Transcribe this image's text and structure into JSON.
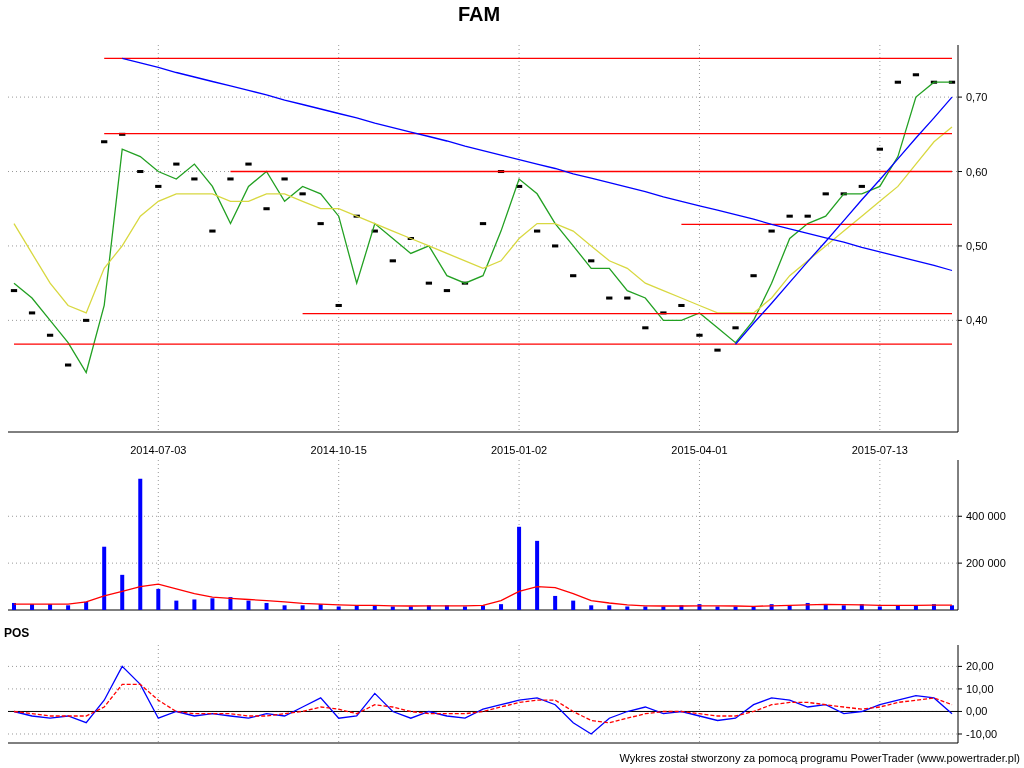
{
  "title": "FAM",
  "price_chart": {
    "chart_data": {
      "type": "line",
      "grid": true,
      "categories": [
        null,
        null,
        null,
        null,
        null,
        null,
        null,
        null,
        "2014-07-03",
        null,
        null,
        null,
        null,
        null,
        null,
        null,
        null,
        null,
        "2014-10-15",
        null,
        null,
        null,
        null,
        null,
        null,
        null,
        null,
        null,
        "2015-01-02",
        null,
        null,
        null,
        null,
        null,
        null,
        null,
        null,
        null,
        "2015-04-01",
        null,
        null,
        null,
        null,
        null,
        null,
        null,
        null,
        null,
        "2015-07-13",
        null,
        null,
        null,
        null
      ],
      "ylim": [
        0.25,
        0.77
      ],
      "yticks": [
        {
          "value": 0.4,
          "label": "0,40"
        },
        {
          "value": 0.5,
          "label": "0,50"
        },
        {
          "value": 0.6,
          "label": "0,60"
        },
        {
          "value": 0.7,
          "label": "0,70"
        }
      ],
      "series": [
        {
          "type": "scatter",
          "color": "#000000",
          "values": [
            0.44,
            0.41,
            0.38,
            0.34,
            0.4,
            0.64,
            0.65,
            0.6,
            0.58,
            0.61,
            0.59,
            0.52,
            0.59,
            0.61,
            0.55,
            0.59,
            0.57,
            0.53,
            0.42,
            0.54,
            0.52,
            0.48,
            0.51,
            0.45,
            0.44,
            0.45,
            0.53,
            0.6,
            0.58,
            0.52,
            0.5,
            0.46,
            0.48,
            0.43,
            0.43,
            0.39,
            0.41,
            0.42,
            0.38,
            0.36,
            0.39,
            0.46,
            0.52,
            0.54,
            0.54,
            0.57,
            0.57,
            0.58,
            0.63,
            0.72,
            0.73,
            0.72,
            0.72
          ]
        },
        {
          "color": "#22a022",
          "values": [
            0.45,
            0.43,
            0.4,
            0.37,
            0.33,
            0.42,
            0.63,
            0.62,
            0.6,
            0.59,
            0.61,
            0.58,
            0.53,
            0.58,
            0.6,
            0.56,
            0.58,
            0.57,
            0.54,
            0.45,
            0.53,
            0.51,
            0.49,
            0.5,
            0.46,
            0.45,
            0.46,
            0.52,
            0.59,
            0.57,
            0.53,
            0.5,
            0.47,
            0.47,
            0.44,
            0.43,
            0.4,
            0.4,
            0.41,
            0.39,
            0.37,
            0.4,
            0.45,
            0.51,
            0.53,
            0.54,
            0.57,
            0.57,
            0.58,
            0.62,
            0.7,
            0.72,
            0.72
          ]
        },
        {
          "color": "#d8d840",
          "values": [
            0.53,
            0.49,
            0.45,
            0.42,
            0.41,
            0.47,
            0.5,
            0.54,
            0.56,
            0.57,
            0.57,
            0.57,
            0.56,
            0.56,
            0.57,
            0.57,
            0.56,
            0.55,
            0.55,
            0.54,
            0.53,
            0.52,
            0.51,
            0.5,
            0.49,
            0.48,
            0.47,
            0.48,
            0.51,
            0.53,
            0.53,
            0.52,
            0.5,
            0.48,
            0.47,
            0.45,
            0.44,
            0.43,
            0.42,
            0.41,
            0.41,
            0.41,
            0.43,
            0.46,
            0.48,
            0.5,
            0.52,
            0.54,
            0.56,
            0.58,
            0.61,
            0.64,
            0.66
          ]
        },
        {
          "color": "#ff0000",
          "values": [
            null,
            null,
            null,
            null,
            null,
            0.752,
            0.752,
            0.752,
            0.752,
            0.752,
            0.752,
            0.752,
            0.752,
            0.752,
            0.752,
            0.752,
            0.752,
            0.752,
            0.752,
            0.752,
            0.752,
            0.752,
            0.752,
            0.752,
            0.752,
            0.752,
            0.752,
            0.752,
            0.752,
            0.752,
            0.752,
            0.752,
            0.752,
            0.752,
            0.752,
            0.752,
            0.752,
            0.752,
            0.752,
            0.752,
            0.752,
            0.752,
            0.752,
            0.752,
            0.752,
            0.752,
            0.752,
            0.752,
            0.752,
            0.752,
            0.752,
            0.752,
            0.752
          ]
        },
        {
          "color": "#ff0000",
          "values": [
            null,
            null,
            null,
            null,
            null,
            0.651,
            0.651,
            0.651,
            0.651,
            0.651,
            0.651,
            0.651,
            0.651,
            0.651,
            0.651,
            0.651,
            0.651,
            0.651,
            0.651,
            0.651,
            0.651,
            0.651,
            0.651,
            0.651,
            0.651,
            0.651,
            0.651,
            0.651,
            0.651,
            0.651,
            0.651,
            0.651,
            0.651,
            0.651,
            0.651,
            0.651,
            0.651,
            0.651,
            0.651,
            0.651,
            0.651,
            0.651,
            0.651,
            0.651,
            0.651,
            0.651,
            0.651,
            0.651,
            0.651,
            0.651,
            0.651,
            0.651,
            0.651
          ]
        },
        {
          "color": "#ff0000",
          "values": [
            null,
            null,
            null,
            null,
            null,
            null,
            null,
            null,
            null,
            null,
            null,
            null,
            0.6,
            0.6,
            0.6,
            0.6,
            0.6,
            0.6,
            0.6,
            0.6,
            0.6,
            0.6,
            0.6,
            0.6,
            0.6,
            0.6,
            0.6,
            0.6,
            0.6,
            0.6,
            0.6,
            0.6,
            0.6,
            0.6,
            0.6,
            0.6,
            0.6,
            0.6,
            0.6,
            0.6,
            0.6,
            0.6,
            0.6,
            0.6,
            0.6,
            0.6,
            0.6,
            0.6,
            0.6,
            0.6,
            0.6,
            0.6,
            0.6
          ]
        },
        {
          "color": "#ff0000",
          "values": [
            null,
            null,
            null,
            null,
            null,
            null,
            null,
            null,
            null,
            null,
            null,
            null,
            null,
            null,
            null,
            null,
            null,
            null,
            null,
            null,
            null,
            null,
            null,
            null,
            null,
            null,
            null,
            null,
            null,
            null,
            null,
            null,
            null,
            null,
            null,
            null,
            null,
            0.529,
            0.529,
            0.529,
            0.529,
            0.529,
            0.529,
            0.529,
            0.529,
            0.529,
            0.529,
            0.529,
            0.529,
            0.529,
            0.529,
            0.529,
            0.529
          ]
        },
        {
          "color": "#ff0000",
          "values": [
            null,
            null,
            null,
            null,
            null,
            null,
            null,
            null,
            null,
            null,
            null,
            null,
            null,
            null,
            null,
            null,
            0.409,
            0.409,
            0.409,
            0.409,
            0.409,
            0.409,
            0.409,
            0.409,
            0.409,
            0.409,
            0.409,
            0.409,
            0.409,
            0.409,
            0.409,
            0.409,
            0.409,
            0.409,
            0.409,
            0.409,
            0.409,
            0.409,
            0.409,
            0.409,
            0.409,
            0.409,
            0.409,
            0.409,
            0.409,
            0.409,
            0.409,
            0.409,
            0.409,
            0.409,
            0.409,
            0.409,
            0.409
          ]
        },
        {
          "color": "#ff0000",
          "values": [
            0.368,
            0.368,
            0.368,
            0.368,
            0.368,
            0.368,
            0.368,
            0.368,
            0.368,
            0.368,
            0.368,
            0.368,
            0.368,
            0.368,
            0.368,
            0.368,
            0.368,
            0.368,
            0.368,
            0.368,
            0.368,
            0.368,
            0.368,
            0.368,
            0.368,
            0.368,
            0.368,
            0.368,
            0.368,
            0.368,
            0.368,
            0.368,
            0.368,
            0.368,
            0.368,
            0.368,
            0.368,
            0.368,
            0.368,
            0.368,
            0.368,
            0.368,
            0.368,
            0.368,
            0.368,
            0.368,
            0.368,
            0.368,
            0.368,
            0.368,
            0.368,
            0.368,
            0.368
          ]
        },
        {
          "color": "#0000ff",
          "values": [
            null,
            null,
            null,
            null,
            null,
            null,
            0.752,
            0.746,
            0.74,
            0.733,
            0.727,
            0.721,
            0.715,
            0.709,
            0.703,
            0.696,
            0.69,
            0.684,
            0.678,
            0.672,
            0.665,
            0.659,
            0.653,
            0.647,
            0.641,
            0.634,
            0.628,
            0.622,
            0.616,
            0.61,
            0.604,
            0.597,
            0.591,
            0.585,
            0.579,
            0.573,
            0.566,
            0.56,
            0.554,
            0.548,
            0.542,
            0.536,
            0.529,
            0.523,
            0.517,
            0.511,
            0.505,
            0.498,
            0.492,
            0.486,
            0.48,
            0.474,
            0.467
          ]
        },
        {
          "color": "#0000ff",
          "values": [
            null,
            null,
            null,
            null,
            null,
            null,
            null,
            null,
            null,
            null,
            null,
            null,
            null,
            null,
            null,
            null,
            null,
            null,
            null,
            null,
            null,
            null,
            null,
            null,
            null,
            null,
            null,
            null,
            null,
            null,
            null,
            null,
            null,
            null,
            null,
            null,
            null,
            null,
            null,
            null,
            0.368,
            0.396,
            0.423,
            0.451,
            0.479,
            0.506,
            0.534,
            0.562,
            0.589,
            0.617,
            0.645,
            0.672,
            0.7
          ]
        }
      ]
    }
  },
  "volume_chart": {
    "chart_data": {
      "type": "bar",
      "grid": true,
      "categories": [
        null,
        null,
        null,
        null,
        null,
        null,
        null,
        null,
        null,
        null,
        null,
        null,
        null,
        null,
        null,
        null,
        null,
        null,
        null,
        null,
        null,
        null,
        null,
        null,
        null,
        null,
        null,
        null,
        null,
        null,
        null,
        null,
        null,
        null,
        null,
        null,
        null,
        null,
        null,
        null,
        null,
        null,
        null,
        null,
        null,
        null,
        null,
        null,
        null,
        null,
        null,
        null,
        null
      ],
      "ylim": [
        0,
        640000
      ],
      "yticks": [
        {
          "value": 200000,
          "label": "200 000"
        },
        {
          "value": 400000,
          "label": "400 000"
        }
      ],
      "series": [
        {
          "color": "#0000ff",
          "values": [
            30000,
            25000,
            25000,
            20000,
            35000,
            270000,
            150000,
            560000,
            90000,
            40000,
            45000,
            50000,
            55000,
            40000,
            30000,
            20000,
            20000,
            25000,
            15000,
            20000,
            20000,
            15000,
            15000,
            20000,
            20000,
            15000,
            20000,
            25000,
            355000,
            295000,
            60000,
            40000,
            20000,
            20000,
            15000,
            15000,
            15000,
            20000,
            25000,
            15000,
            15000,
            15000,
            25000,
            20000,
            30000,
            25000,
            20000,
            25000,
            15000,
            20000,
            20000,
            25000,
            20000
          ]
        },
        {
          "type": "line",
          "color": "#ff0000",
          "values": [
            25000,
            25000,
            25000,
            25000,
            35000,
            60000,
            80000,
            100000,
            110000,
            90000,
            70000,
            55000,
            50000,
            45000,
            40000,
            35000,
            28000,
            25000,
            22000,
            20000,
            20000,
            18000,
            17000,
            18000,
            18000,
            18000,
            20000,
            40000,
            80000,
            100000,
            95000,
            70000,
            40000,
            30000,
            22000,
            18000,
            17000,
            17000,
            18000,
            18000,
            17000,
            16000,
            18000,
            20000,
            22000,
            24000,
            23000,
            22000,
            20000,
            20000,
            20000,
            21000,
            21000
          ]
        }
      ]
    }
  },
  "pos_chart": {
    "title": "POS",
    "chart_data": {
      "type": "line",
      "grid": true,
      "categories": [
        null,
        null,
        null,
        null,
        null,
        null,
        null,
        null,
        null,
        null,
        null,
        null,
        null,
        null,
        null,
        null,
        null,
        null,
        null,
        null,
        null,
        null,
        null,
        null,
        null,
        null,
        null,
        null,
        null,
        null,
        null,
        null,
        null,
        null,
        null,
        null,
        null,
        null,
        null,
        null,
        null,
        null,
        null,
        null,
        null,
        null,
        null,
        null,
        null,
        null,
        null,
        null,
        null
      ],
      "ylim": [
        -14,
        29.5
      ],
      "yticks": [
        {
          "value": -10,
          "label": "-10,00"
        },
        {
          "value": 0,
          "label": "0,00"
        },
        {
          "value": 10,
          "label": "10,00"
        },
        {
          "value": 20,
          "label": "20,00"
        }
      ],
      "series": [
        {
          "color": "#0000ff",
          "line_style": "solid",
          "values": [
            0,
            -2,
            -3,
            -2,
            -5,
            5,
            20,
            12,
            -3,
            0,
            -2,
            -1,
            -2,
            -3,
            -1,
            -2,
            2,
            6,
            -3,
            -2,
            8,
            0,
            -3,
            0,
            -2,
            -3,
            1,
            3,
            5,
            6,
            3,
            -5,
            -10,
            -3,
            0,
            2,
            -1,
            0,
            -2,
            -4,
            -3,
            3,
            6,
            5,
            2,
            3,
            -1,
            0,
            3,
            5,
            7,
            6,
            -1
          ]
        },
        {
          "color": "#ff0000",
          "line_style": "dashed",
          "values": [
            0,
            -1,
            -2,
            -2,
            -2,
            2,
            12,
            12,
            5,
            0,
            -1,
            -1,
            -1,
            -2,
            -2,
            -1,
            0,
            2,
            1,
            -1,
            3,
            2,
            0,
            -1,
            -1,
            -1,
            0,
            2,
            4,
            5,
            5,
            0,
            -4,
            -5,
            -3,
            -1,
            0,
            0,
            -1,
            -2,
            -2,
            0,
            3,
            4,
            4,
            3,
            2,
            1,
            2,
            4,
            5,
            6,
            3
          ]
        }
      ]
    }
  },
  "footer": "Wykres został stworzony za pomocą programu PowerTrader (www.powertrader.pl)"
}
